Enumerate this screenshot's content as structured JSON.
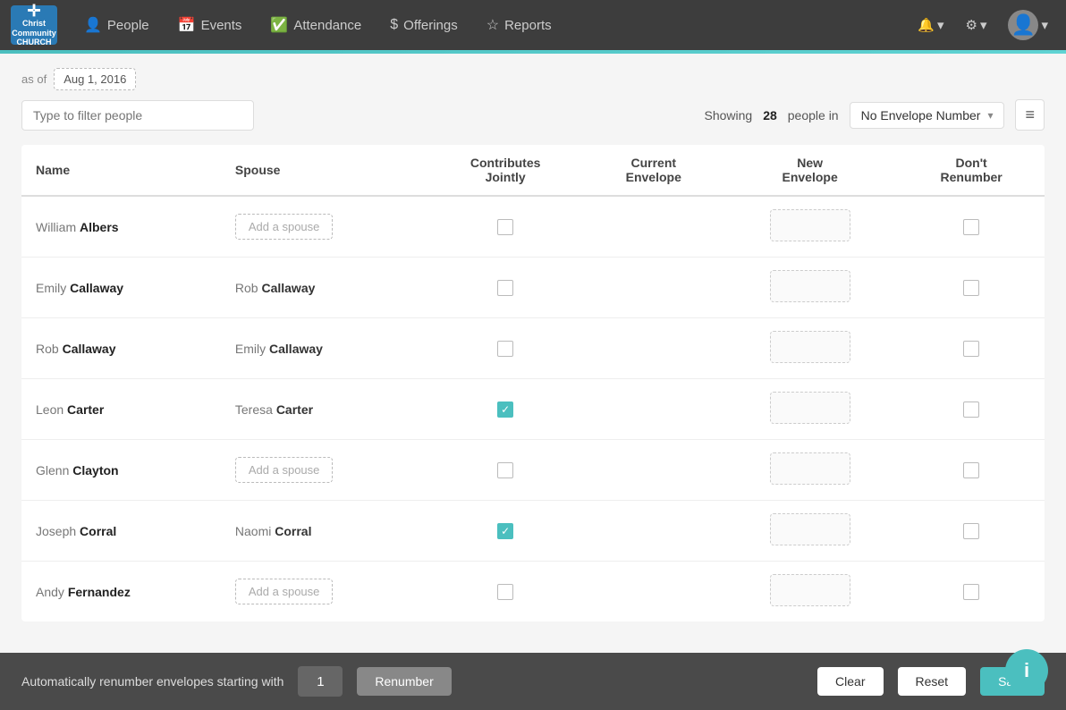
{
  "app": {
    "logo": {
      "line1": "Christ",
      "line2": "Community",
      "line3": "CHURCH",
      "cross": "✛"
    }
  },
  "navbar": {
    "items": [
      {
        "id": "people",
        "label": "People",
        "icon": "👤",
        "active": true
      },
      {
        "id": "events",
        "label": "Events",
        "icon": "📅",
        "active": false
      },
      {
        "id": "attendance",
        "label": "Attendance",
        "icon": "✅",
        "active": false
      },
      {
        "id": "offerings",
        "label": "Offerings",
        "icon": "💰",
        "active": false
      },
      {
        "id": "reports",
        "label": "Reports",
        "icon": "⭐",
        "active": false
      }
    ],
    "right": {
      "bell_label": "🔔",
      "gear_label": "⚙",
      "caret": "▾"
    }
  },
  "filter": {
    "as_of_label": "as of",
    "date_value": "Aug 1, 2016",
    "input_placeholder": "Type to filter people"
  },
  "showing": {
    "prefix": "Showing",
    "count": "28",
    "suffix": "people in",
    "dropdown_value": "No Envelope Number"
  },
  "table": {
    "columns": {
      "name": "Name",
      "spouse": "Spouse",
      "contributes_jointly": "Contributes\nJointly",
      "current_envelope": "Current\nEnvelope",
      "new_envelope": "New\nEnvelope",
      "dont_renumber": "Don't\nRenumber"
    },
    "rows": [
      {
        "id": 1,
        "name_first": "William",
        "name_last": "Albers",
        "spouse_type": "add",
        "spouse_label": "Add a spouse",
        "contributes_jointly": false,
        "current_envelope": "",
        "has_new_envelope": true,
        "dont_renumber": false
      },
      {
        "id": 2,
        "name_first": "Emily",
        "name_last": "Callaway",
        "spouse_type": "named",
        "spouse_first": "Rob",
        "spouse_last": "Callaway",
        "contributes_jointly": false,
        "current_envelope": "",
        "has_new_envelope": true,
        "dont_renumber": false
      },
      {
        "id": 3,
        "name_first": "Rob",
        "name_last": "Callaway",
        "spouse_type": "named",
        "spouse_first": "Emily",
        "spouse_last": "Callaway",
        "contributes_jointly": false,
        "current_envelope": "",
        "has_new_envelope": true,
        "dont_renumber": false
      },
      {
        "id": 4,
        "name_first": "Leon",
        "name_last": "Carter",
        "spouse_type": "named",
        "spouse_first": "Teresa",
        "spouse_last": "Carter",
        "contributes_jointly": true,
        "current_envelope": "",
        "has_new_envelope": true,
        "dont_renumber": false
      },
      {
        "id": 5,
        "name_first": "Glenn",
        "name_last": "Clayton",
        "spouse_type": "add",
        "spouse_label": "Add a spouse",
        "contributes_jointly": false,
        "current_envelope": "",
        "has_new_envelope": true,
        "dont_renumber": false
      },
      {
        "id": 6,
        "name_first": "Joseph",
        "name_last": "Corral",
        "spouse_type": "named",
        "spouse_first": "Naomi",
        "spouse_last": "Corral",
        "contributes_jointly": true,
        "current_envelope": "",
        "has_new_envelope": true,
        "dont_renumber": false
      },
      {
        "id": 7,
        "name_first": "Andy",
        "name_last": "Fernandez",
        "spouse_type": "add",
        "spouse_label": "Add a spouse",
        "contributes_jointly": false,
        "current_envelope": "",
        "has_new_envelope": true,
        "dont_renumber": false
      }
    ]
  },
  "footer": {
    "label": "Automatically renumber envelopes starting with",
    "starting_number": "1",
    "btn_renumber": "Renumber",
    "btn_clear": "Clear",
    "btn_reset": "Reset",
    "btn_save": "Save"
  },
  "info_btn": "i"
}
